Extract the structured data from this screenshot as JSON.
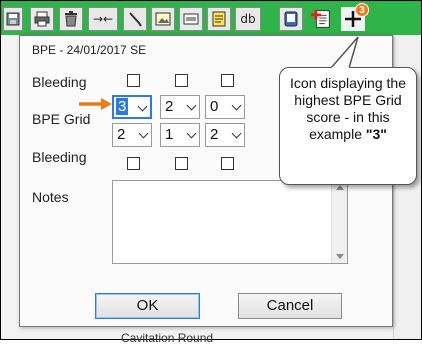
{
  "toolbar": {
    "buttons": [
      {
        "icon": "save-icon"
      },
      {
        "icon": "print-icon"
      },
      {
        "icon": "delete-icon"
      },
      {
        "icon": "merge-icon",
        "glyph": "→←"
      },
      {
        "icon": "probe-icon"
      },
      {
        "icon": "image-icon"
      },
      {
        "icon": "id-card-icon"
      },
      {
        "icon": "note-icon"
      },
      {
        "icon": "database-icon",
        "glyph": "db"
      },
      {
        "icon": "phone-icon"
      },
      {
        "icon": "medical-document-icon"
      },
      {
        "icon": "bpe-icon"
      }
    ],
    "badge_value": "3",
    "badge_color": "#f07a1a",
    "toolbar_color": "#2fb44a"
  },
  "dialog": {
    "title": "BPE - 24/01/2017 SE",
    "bleeding_top_label": "Bleeding",
    "bpe_grid_label": "BPE Grid",
    "bleeding_bottom_label": "Bleeding",
    "notes_label": "Notes",
    "notes_value": "",
    "grid_row1": [
      "3",
      "2",
      "0"
    ],
    "grid_row2": [
      "2",
      "1",
      "2"
    ],
    "bleeding_top_checked": [
      false,
      false,
      false
    ],
    "bleeding_bottom_checked": [
      false,
      false,
      false
    ],
    "ok_label": "OK",
    "cancel_label": "Cancel"
  },
  "callout": {
    "text": "Icon displaying the highest BPE Grid score - in this example",
    "emphasis": "\"3\""
  },
  "background": {
    "cavitation_label": "Cavitation Round"
  },
  "colors": {
    "arrow": "#f07a1a",
    "focus": "#2c7be5"
  }
}
